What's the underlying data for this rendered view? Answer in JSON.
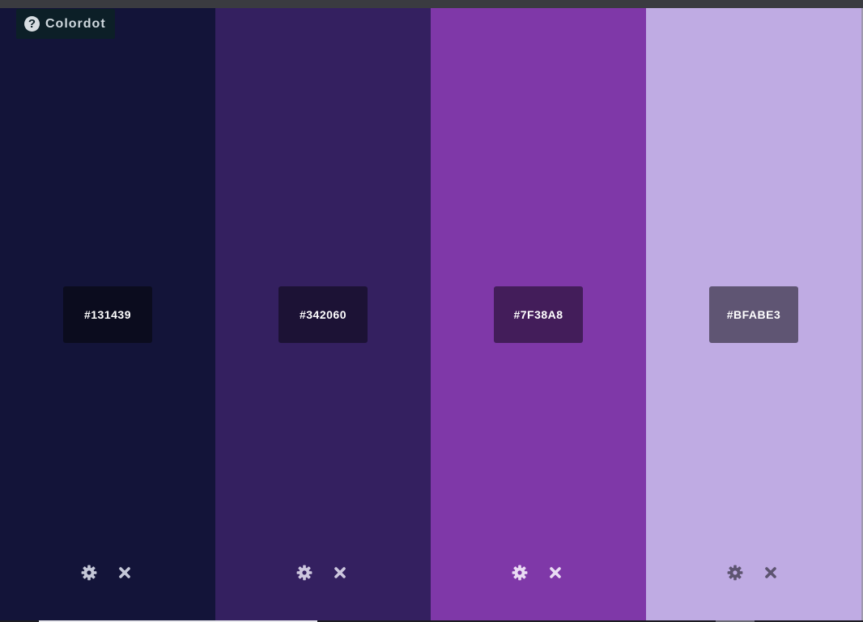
{
  "app": {
    "brand_label": "Colordot",
    "help_icon": "question-circle-icon"
  },
  "swatches": [
    {
      "hex": "#131439",
      "color": "#131439",
      "label_bg": "#0b0c1e",
      "icon_color": "#c5c8d8",
      "settings_icon": "gear-icon",
      "remove_icon": "close-icon"
    },
    {
      "hex": "#342060",
      "color": "#342060",
      "label_bg": "#1c1235",
      "icon_color": "#cdc7de",
      "settings_icon": "gear-icon",
      "remove_icon": "close-icon"
    },
    {
      "hex": "#7F38A8",
      "color": "#7f38a8",
      "label_bg": "#431d5a",
      "icon_color": "#eadcf4",
      "settings_icon": "gear-icon",
      "remove_icon": "close-icon"
    },
    {
      "hex": "#BFABE3",
      "color": "#bfabe3",
      "label_bg": "#5f5573",
      "icon_color": "#5d5470",
      "settings_icon": "gear-icon",
      "remove_icon": "close-icon"
    }
  ]
}
